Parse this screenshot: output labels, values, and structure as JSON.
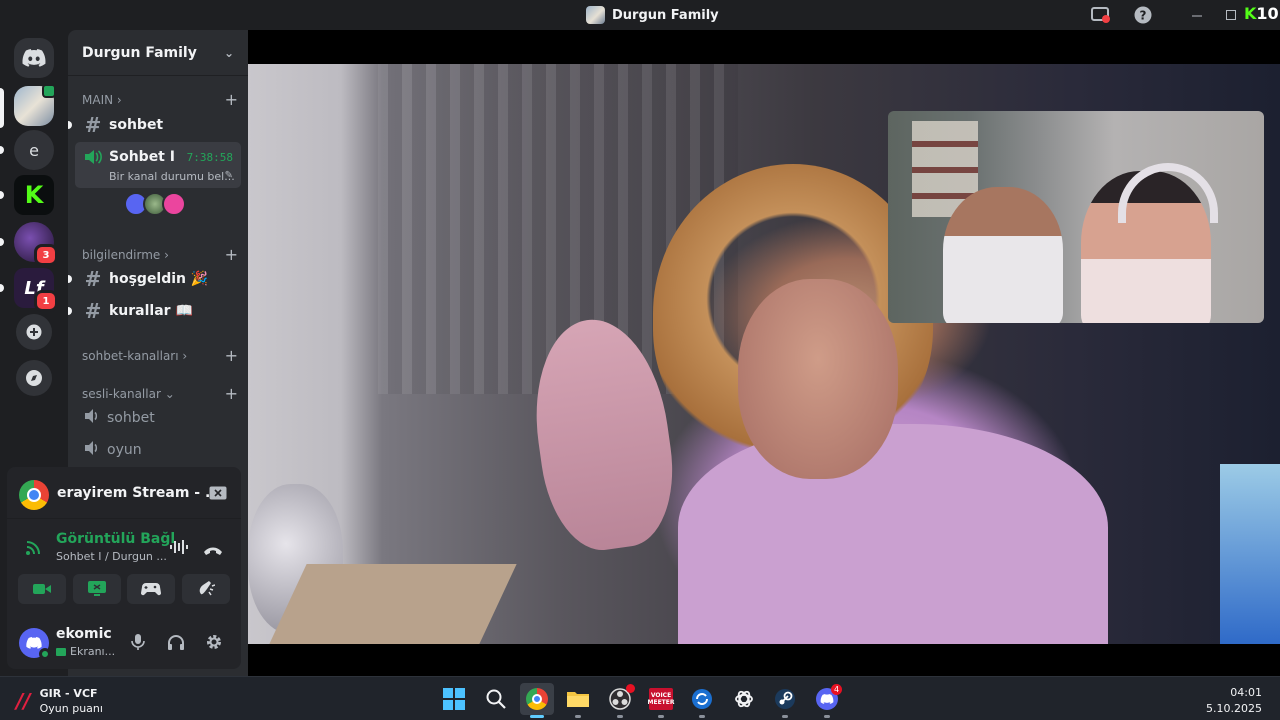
{
  "window": {
    "title": "Durgun Family"
  },
  "guild": {
    "name": "Durgun Family"
  },
  "rail": {
    "badges": [
      "3",
      "1"
    ],
    "letter_server": "e"
  },
  "categories": {
    "main": "MAIN",
    "info": "bilgilendirme",
    "chat": "sohbet-kanalları",
    "voice": "sesli-kanallar"
  },
  "channels": {
    "sohbet_text": "sohbet",
    "voice_active": {
      "name": "Sohbet I",
      "timer": "7:38:58",
      "status": "Bir kanal durumu bel..."
    },
    "hosgeldin": "hoşgeldin 🎉",
    "kurallar": "kurallar 📖",
    "voice_sohbet": "sohbet",
    "voice_oyun": "oyun"
  },
  "stream": {
    "title": "erayirem Stream - ..."
  },
  "connection": {
    "title": "Görüntülü Bağl",
    "subtitle": "Sohbet I / Durgun ..."
  },
  "user": {
    "name": "ekomic",
    "status": "Ekranı..."
  },
  "taskbar": {
    "widget_title": "GIR - VCF",
    "widget_subtitle": "Oyun puanı",
    "voicemeeter_label": "VOICE MEETER",
    "discord_badge": "4",
    "time": "04:01",
    "date": "5.10.2025"
  },
  "titlebar": {
    "app_badge_text": "10"
  },
  "colors": {
    "green": "#23a55a",
    "blurple": "#5865f2",
    "kick": "#53fc18",
    "red": "#f23f43"
  }
}
